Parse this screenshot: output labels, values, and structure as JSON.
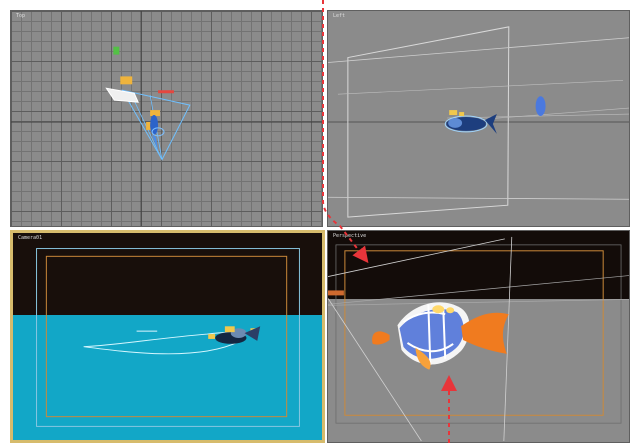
{
  "viewports": [
    {
      "label": "Top"
    },
    {
      "label": "Left"
    },
    {
      "label": "Camera01"
    },
    {
      "label": "Perspective"
    }
  ],
  "colors": {
    "active_border": "#d6bb6c",
    "viewport_gray": "#8b8b8b",
    "water": "#12a7c7",
    "dark_bg": "#180f0b",
    "annotation_red": "#e8353a",
    "safe_frame": "#cc8a3a",
    "grid_line": "#737373"
  },
  "annotations": {
    "arrows": [
      "camera-target-arrow",
      "fish-arrow"
    ]
  }
}
